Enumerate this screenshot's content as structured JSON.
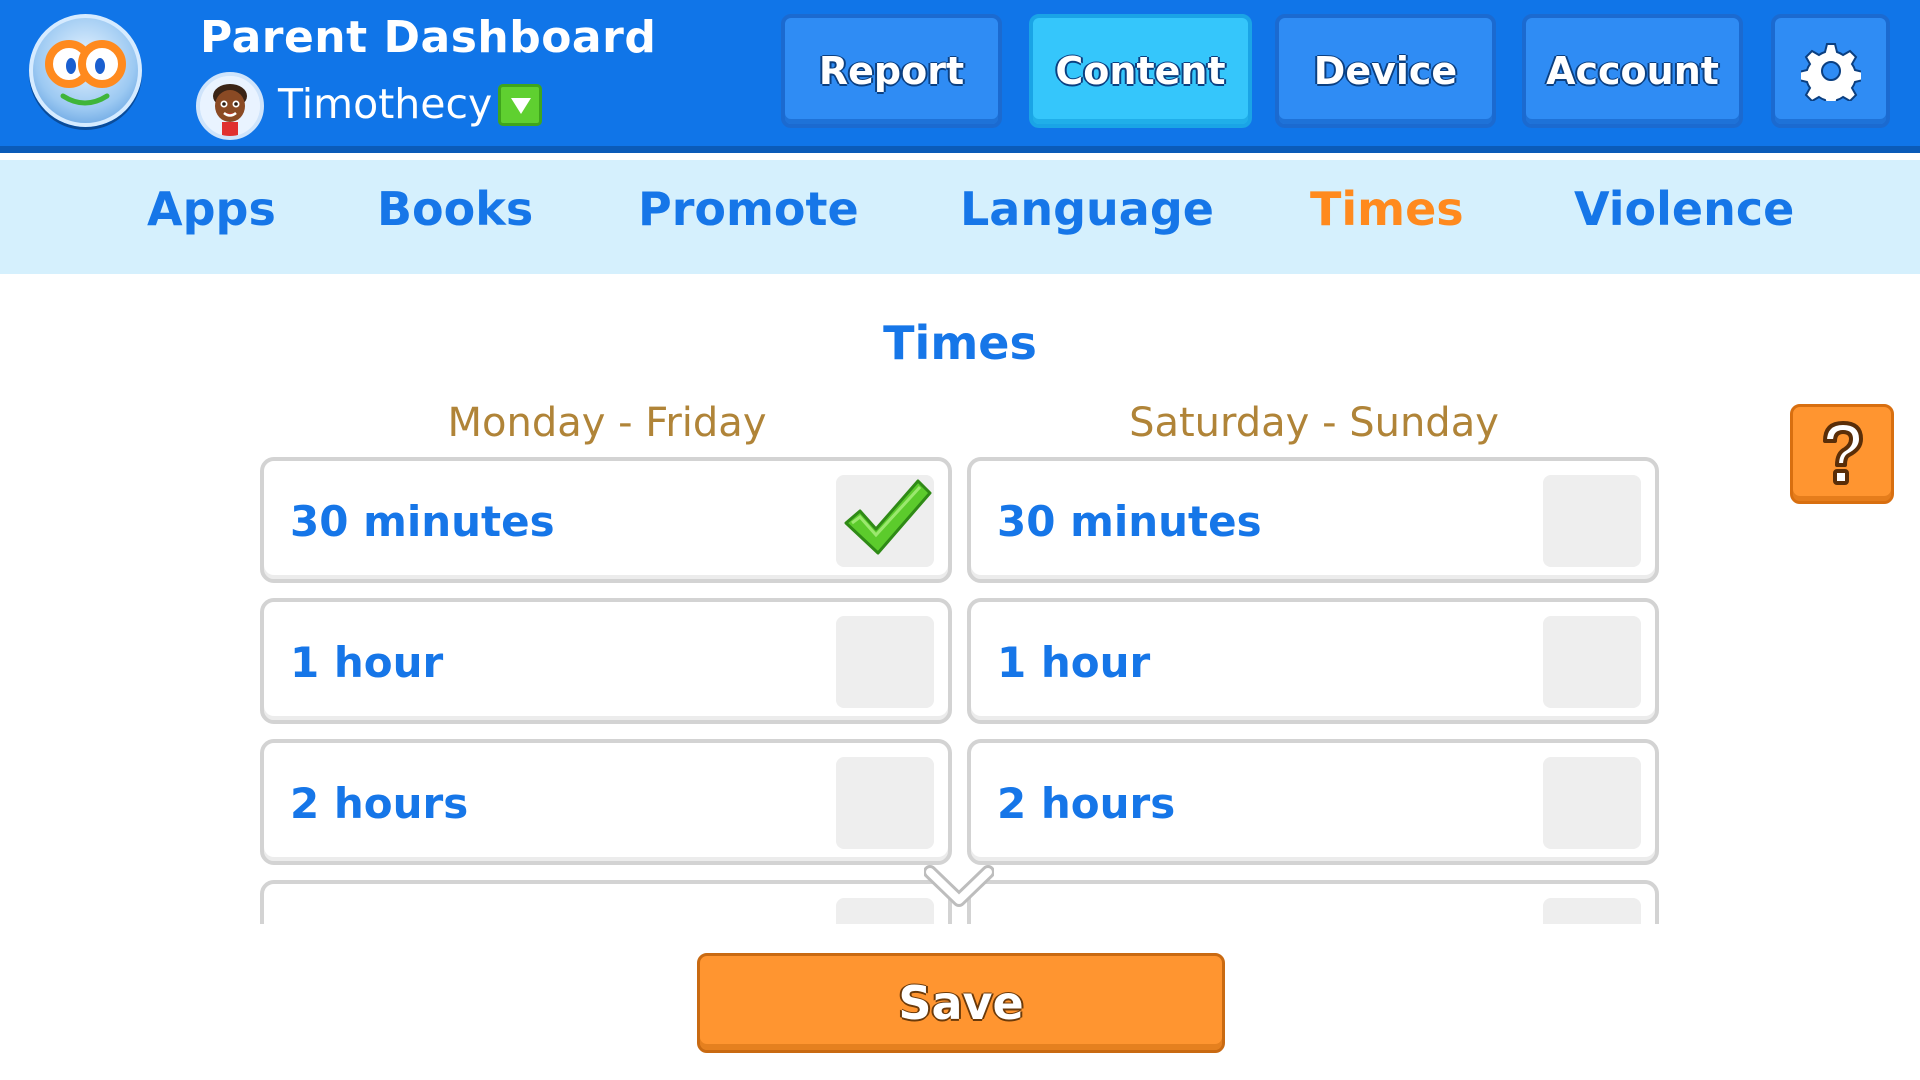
{
  "header": {
    "title": "Parent Dashboard",
    "child_name": "Timothecy",
    "buttons": [
      {
        "label": "Report",
        "active": false
      },
      {
        "label": "Content",
        "active": true
      },
      {
        "label": "Device",
        "active": false
      },
      {
        "label": "Account",
        "active": false
      }
    ],
    "settings_icon": "gear-icon"
  },
  "subnav": {
    "items": [
      {
        "label": "Apps",
        "active": false
      },
      {
        "label": "Books",
        "active": false
      },
      {
        "label": "Promote",
        "active": false
      },
      {
        "label": "Language",
        "active": false
      },
      {
        "label": "Times",
        "active": true
      },
      {
        "label": "Violence",
        "active": false
      }
    ]
  },
  "main": {
    "title": "Times",
    "columns": [
      {
        "header": "Monday - Friday",
        "options": [
          {
            "label": "30 minutes",
            "checked": true
          },
          {
            "label": "1 hour",
            "checked": false
          },
          {
            "label": "2 hours",
            "checked": false
          }
        ]
      },
      {
        "header": "Saturday - Sunday",
        "options": [
          {
            "label": "30 minutes",
            "checked": false
          },
          {
            "label": "1 hour",
            "checked": false
          },
          {
            "label": "2 hours",
            "checked": false
          }
        ]
      }
    ]
  },
  "help": {
    "icon": "question-mark-icon"
  },
  "save_label": "Save",
  "colors": {
    "header_blue": "#1075e8",
    "active_tab_cyan": "#35c6fb",
    "subnav_bg": "#d5f0fd",
    "text_blue": "#1676e8",
    "active_orange": "#ff8a1e",
    "column_header_tan": "#b08438",
    "check_green": "#5ccb2c"
  }
}
